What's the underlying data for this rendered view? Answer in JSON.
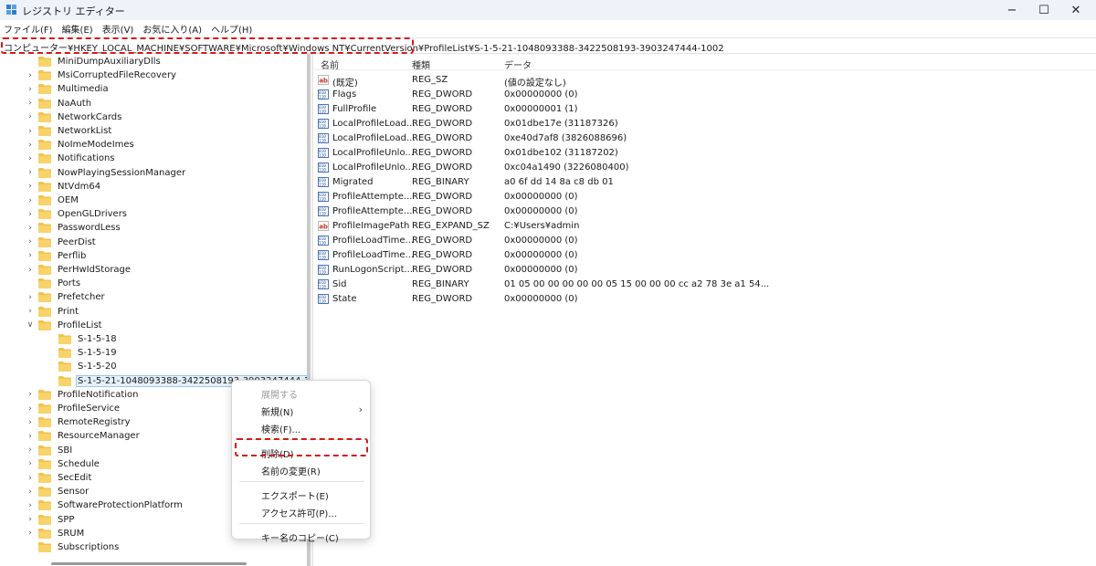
{
  "window": {
    "title": "レジストリ エディター",
    "minimize_glyph": "−",
    "maximize_glyph": "☐",
    "close_glyph": "✕"
  },
  "menu": [
    "ファイル(F)",
    "編集(E)",
    "表示(V)",
    "お気に入り(A)",
    "ヘルプ(H)"
  ],
  "address": {
    "path": "コンピューター¥HKEY_LOCAL_MACHINE¥SOFTWARE¥Microsoft¥Windows NT¥CurrentVersion¥ProfileList¥S-1-5-21-1048093388-3422508193-3903247444-1002"
  },
  "tree": {
    "items": [
      {
        "label": "MiniDumpAuxiliaryDlls",
        "expandable": false
      },
      {
        "label": "MsiCorruptedFileRecovery",
        "expandable": true
      },
      {
        "label": "Multimedia",
        "expandable": true
      },
      {
        "label": "NaAuth",
        "expandable": true
      },
      {
        "label": "NetworkCards",
        "expandable": true
      },
      {
        "label": "NetworkList",
        "expandable": true
      },
      {
        "label": "NoImeModeImes",
        "expandable": true
      },
      {
        "label": "Notifications",
        "expandable": true
      },
      {
        "label": "NowPlayingSessionManager",
        "expandable": true
      },
      {
        "label": "NtVdm64",
        "expandable": true
      },
      {
        "label": "OEM",
        "expandable": true
      },
      {
        "label": "OpenGLDrivers",
        "expandable": true
      },
      {
        "label": "PasswordLess",
        "expandable": true
      },
      {
        "label": "PeerDist",
        "expandable": true
      },
      {
        "label": "Perflib",
        "expandable": true
      },
      {
        "label": "PerHwIdStorage",
        "expandable": true
      },
      {
        "label": "Ports",
        "expandable": false
      },
      {
        "label": "Prefetcher",
        "expandable": true
      },
      {
        "label": "Print",
        "expandable": true
      },
      {
        "label": "ProfileList",
        "expandable": true,
        "expanded": true
      },
      {
        "label": "S-1-5-18",
        "expandable": false,
        "child": true
      },
      {
        "label": "S-1-5-19",
        "expandable": false,
        "child": true
      },
      {
        "label": "S-1-5-20",
        "expandable": false,
        "child": true
      },
      {
        "label": "S-1-5-21-1048093388-3422508193-3903247444-1002",
        "expandable": false,
        "child": true,
        "selected": true
      },
      {
        "label": "ProfileNotification",
        "expandable": true
      },
      {
        "label": "ProfileService",
        "expandable": true
      },
      {
        "label": "RemoteRegistry",
        "expandable": true
      },
      {
        "label": "ResourceManager",
        "expandable": true
      },
      {
        "label": "SBI",
        "expandable": true
      },
      {
        "label": "Schedule",
        "expandable": true
      },
      {
        "label": "SecEdit",
        "expandable": true
      },
      {
        "label": "Sensor",
        "expandable": true
      },
      {
        "label": "SoftwareProtectionPlatform",
        "expandable": true
      },
      {
        "label": "SPP",
        "expandable": true
      },
      {
        "label": "SRUM",
        "expandable": true
      },
      {
        "label": "Subscriptions",
        "expandable": false
      }
    ]
  },
  "values": {
    "headers": {
      "name": "名前",
      "type": "種類",
      "data": "データ"
    },
    "rows": [
      {
        "name": "(既定)",
        "type": "REG_SZ",
        "data": "(値の設定なし)",
        "icon": "string-value-icon"
      },
      {
        "name": "Flags",
        "type": "REG_DWORD",
        "data": "0x00000000 (0)",
        "icon": "binary-value-icon"
      },
      {
        "name": "FullProfile",
        "type": "REG_DWORD",
        "data": "0x00000001 (1)",
        "icon": "binary-value-icon"
      },
      {
        "name": "LocalProfileLoad...",
        "type": "REG_DWORD",
        "data": "0x01dbe17e (31187326)",
        "icon": "binary-value-icon"
      },
      {
        "name": "LocalProfileLoad...",
        "type": "REG_DWORD",
        "data": "0xe40d7af8 (3826088696)",
        "icon": "binary-value-icon"
      },
      {
        "name": "LocalProfileUnlo...",
        "type": "REG_DWORD",
        "data": "0x01dbe102 (31187202)",
        "icon": "binary-value-icon"
      },
      {
        "name": "LocalProfileUnlo...",
        "type": "REG_DWORD",
        "data": "0xc04a1490 (3226080400)",
        "icon": "binary-value-icon"
      },
      {
        "name": "Migrated",
        "type": "REG_BINARY",
        "data": "a0 6f dd 14 8a c8 db 01",
        "icon": "binary-value-icon"
      },
      {
        "name": "ProfileAttempte...",
        "type": "REG_DWORD",
        "data": "0x00000000 (0)",
        "icon": "binary-value-icon"
      },
      {
        "name": "ProfileAttempte...",
        "type": "REG_DWORD",
        "data": "0x00000000 (0)",
        "icon": "binary-value-icon"
      },
      {
        "name": "ProfileImagePath",
        "type": "REG_EXPAND_SZ",
        "data": "C:¥Users¥admin",
        "icon": "string-value-icon"
      },
      {
        "name": "ProfileLoadTime...",
        "type": "REG_DWORD",
        "data": "0x00000000 (0)",
        "icon": "binary-value-icon"
      },
      {
        "name": "ProfileLoadTime...",
        "type": "REG_DWORD",
        "data": "0x00000000 (0)",
        "icon": "binary-value-icon"
      },
      {
        "name": "RunLogonScript...",
        "type": "REG_DWORD",
        "data": "0x00000000 (0)",
        "icon": "binary-value-icon"
      },
      {
        "name": "Sid",
        "type": "REG_BINARY",
        "data": "01 05 00 00 00 00 00 05 15 00 00 00 cc a2 78 3e a1 54...",
        "icon": "binary-value-icon"
      },
      {
        "name": "State",
        "type": "REG_DWORD",
        "data": "0x00000000 (0)",
        "icon": "binary-value-icon"
      }
    ]
  },
  "context_menu": {
    "items": [
      {
        "label": "展開する",
        "disabled": true
      },
      {
        "label": "新規(N)",
        "submenu": true
      },
      {
        "label": "検索(F)..."
      },
      {
        "separator": true
      },
      {
        "label": "削除(D)",
        "highlight": true
      },
      {
        "label": "名前の変更(R)"
      },
      {
        "separator": true
      },
      {
        "label": "エクスポート(E)"
      },
      {
        "label": "アクセス許可(P)..."
      },
      {
        "separator": true
      },
      {
        "label": "キー名のコピー(C)"
      }
    ]
  },
  "colors": {
    "highlight_border": "#d11b1b",
    "folder": "#f2c24b",
    "selection": "#e5f1fb",
    "titlebar": "#eef3fa"
  }
}
